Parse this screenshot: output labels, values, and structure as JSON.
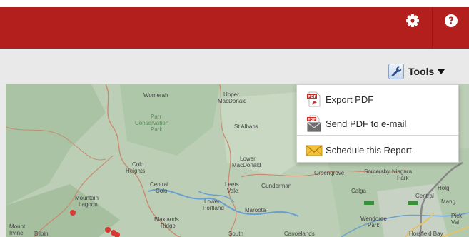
{
  "header": {
    "settings_icon": "gear-icon",
    "help_icon": "help-icon",
    "brand_color": "#b21f1c"
  },
  "toolbar": {
    "tools_label": "Tools",
    "tools_icon": "wrench-icon"
  },
  "tools_menu": {
    "items": [
      {
        "label": "Export PDF",
        "icon": "pdf-icon"
      },
      {
        "label": "Send PDF to e-mail",
        "icon": "pdf-email-icon"
      },
      {
        "label": "Schedule this Report",
        "icon": "envelope-icon"
      }
    ]
  },
  "map": {
    "labels": [
      "Womerah",
      "Upper",
      "MacDonald",
      "Parr",
      "Conservation",
      "Park",
      "St Albans",
      "Lower",
      "MacDonald",
      "Colo",
      "Heights",
      "Central",
      "Colo",
      "Leets",
      "Vale",
      "Gunderman",
      "Greengrove",
      "Somersby",
      "Niagara",
      "Park",
      "Mountain",
      "Lagoon",
      "Lower",
      "Portland",
      "Maroota",
      "Calga",
      "Holg",
      "Central",
      "Mang",
      "Blaxlands",
      "Ridge",
      "Wendoree",
      "Park",
      "Pick",
      "Val",
      "Mount",
      "Irvine",
      "Bilpin",
      "South",
      "Canoelands",
      "Horsfield Bay"
    ]
  }
}
